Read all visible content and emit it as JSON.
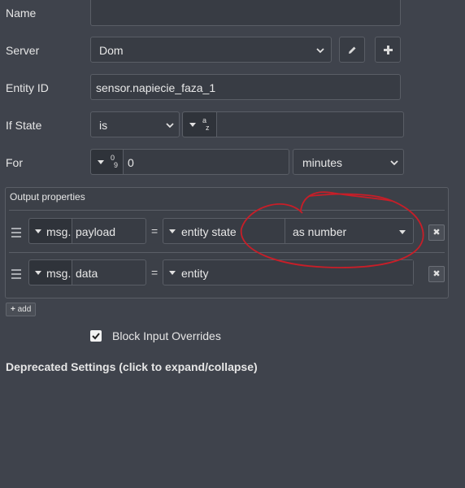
{
  "form": {
    "name": {
      "label": "Name",
      "value": ""
    },
    "server": {
      "label": "Server",
      "value": "Dom"
    },
    "entity_id": {
      "label": "Entity ID",
      "value": "sensor.napiecie_faza_1"
    },
    "if_state": {
      "label": "If State",
      "operator": "is",
      "type_glyph_top": "a",
      "type_glyph_bottom": "z",
      "value": ""
    },
    "for": {
      "label": "For",
      "type_glyph_top": "0",
      "type_glyph_bottom": "9",
      "value": "0",
      "unit": "minutes"
    }
  },
  "output_properties": {
    "title": "Output properties",
    "rows": [
      {
        "prefix": "msg.",
        "property": "payload",
        "equals": "=",
        "value_type": "entity state",
        "format": "as number"
      },
      {
        "prefix": "msg.",
        "property": "data",
        "equals": "=",
        "value_type": "entity"
      }
    ],
    "add_label": "add"
  },
  "block_input_overrides": {
    "label": "Block Input Overrides",
    "checked": true
  },
  "deprecated_settings": {
    "label": "Deprecated Settings (click to expand/collapse)"
  },
  "colors": {
    "background": "#3f434c",
    "input_bg": "#383c44",
    "border": "#5a5e66",
    "annotation": "#c81e28"
  },
  "icons": [
    "pencil-icon",
    "plus-icon",
    "chevron-down-icon",
    "caret-down-icon",
    "drag-handle-icon",
    "close-icon",
    "checkbox-icon"
  ]
}
